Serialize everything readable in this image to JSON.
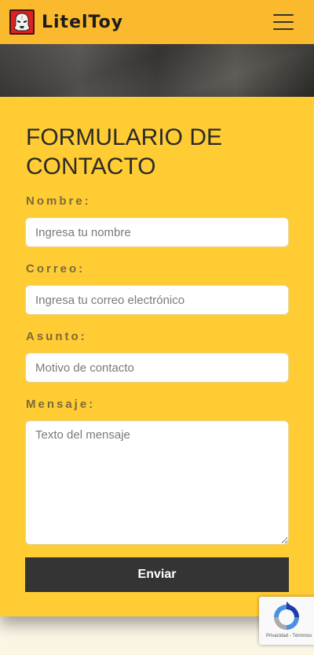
{
  "header": {
    "brand_name": "LitelToy",
    "logo_icon": "stormtrooper-icon",
    "menu_icon": "hamburger-menu-icon"
  },
  "form": {
    "title": "FORMULARIO DE CONTACTO",
    "name_label": "Nombre:",
    "name_placeholder": "Ingresa tu nombre",
    "email_label": "Correo:",
    "email_placeholder": "Ingresa tu correo electrónico",
    "subject_label": "Asunto:",
    "subject_placeholder": "Motivo de contacto",
    "message_label": "Mensaje:",
    "message_placeholder": "Texto del mensaje",
    "submit_label": "Enviar"
  },
  "recaptcha": {
    "links": "Privacidad - Términos",
    "icon": "recaptcha-icon"
  },
  "colors": {
    "navbar": "#fbb92d",
    "form_background": "#ffcc33",
    "button": "#343434"
  }
}
